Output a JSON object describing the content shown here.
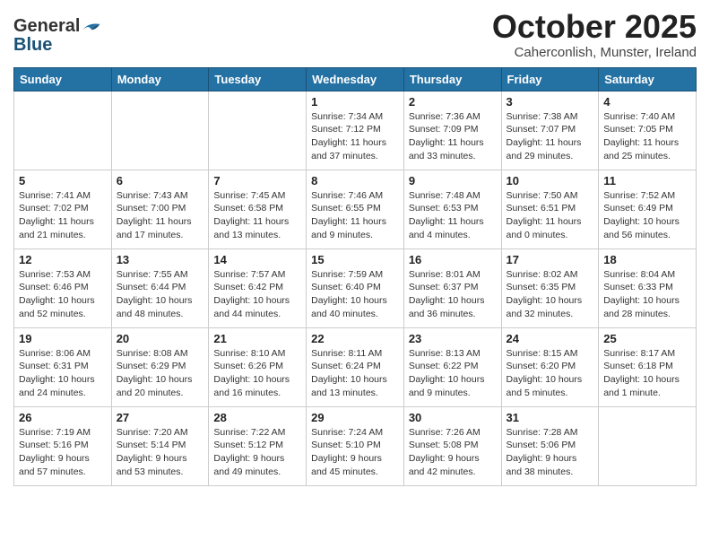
{
  "header": {
    "logo_general": "General",
    "logo_blue": "Blue",
    "month": "October 2025",
    "location": "Caherconlish, Munster, Ireland"
  },
  "weekdays": [
    "Sunday",
    "Monday",
    "Tuesday",
    "Wednesday",
    "Thursday",
    "Friday",
    "Saturday"
  ],
  "weeks": [
    [
      {
        "day": "",
        "info": ""
      },
      {
        "day": "",
        "info": ""
      },
      {
        "day": "",
        "info": ""
      },
      {
        "day": "1",
        "info": "Sunrise: 7:34 AM\nSunset: 7:12 PM\nDaylight: 11 hours\nand 37 minutes."
      },
      {
        "day": "2",
        "info": "Sunrise: 7:36 AM\nSunset: 7:09 PM\nDaylight: 11 hours\nand 33 minutes."
      },
      {
        "day": "3",
        "info": "Sunrise: 7:38 AM\nSunset: 7:07 PM\nDaylight: 11 hours\nand 29 minutes."
      },
      {
        "day": "4",
        "info": "Sunrise: 7:40 AM\nSunset: 7:05 PM\nDaylight: 11 hours\nand 25 minutes."
      }
    ],
    [
      {
        "day": "5",
        "info": "Sunrise: 7:41 AM\nSunset: 7:02 PM\nDaylight: 11 hours\nand 21 minutes."
      },
      {
        "day": "6",
        "info": "Sunrise: 7:43 AM\nSunset: 7:00 PM\nDaylight: 11 hours\nand 17 minutes."
      },
      {
        "day": "7",
        "info": "Sunrise: 7:45 AM\nSunset: 6:58 PM\nDaylight: 11 hours\nand 13 minutes."
      },
      {
        "day": "8",
        "info": "Sunrise: 7:46 AM\nSunset: 6:55 PM\nDaylight: 11 hours\nand 9 minutes."
      },
      {
        "day": "9",
        "info": "Sunrise: 7:48 AM\nSunset: 6:53 PM\nDaylight: 11 hours\nand 4 minutes."
      },
      {
        "day": "10",
        "info": "Sunrise: 7:50 AM\nSunset: 6:51 PM\nDaylight: 11 hours\nand 0 minutes."
      },
      {
        "day": "11",
        "info": "Sunrise: 7:52 AM\nSunset: 6:49 PM\nDaylight: 10 hours\nand 56 minutes."
      }
    ],
    [
      {
        "day": "12",
        "info": "Sunrise: 7:53 AM\nSunset: 6:46 PM\nDaylight: 10 hours\nand 52 minutes."
      },
      {
        "day": "13",
        "info": "Sunrise: 7:55 AM\nSunset: 6:44 PM\nDaylight: 10 hours\nand 48 minutes."
      },
      {
        "day": "14",
        "info": "Sunrise: 7:57 AM\nSunset: 6:42 PM\nDaylight: 10 hours\nand 44 minutes."
      },
      {
        "day": "15",
        "info": "Sunrise: 7:59 AM\nSunset: 6:40 PM\nDaylight: 10 hours\nand 40 minutes."
      },
      {
        "day": "16",
        "info": "Sunrise: 8:01 AM\nSunset: 6:37 PM\nDaylight: 10 hours\nand 36 minutes."
      },
      {
        "day": "17",
        "info": "Sunrise: 8:02 AM\nSunset: 6:35 PM\nDaylight: 10 hours\nand 32 minutes."
      },
      {
        "day": "18",
        "info": "Sunrise: 8:04 AM\nSunset: 6:33 PM\nDaylight: 10 hours\nand 28 minutes."
      }
    ],
    [
      {
        "day": "19",
        "info": "Sunrise: 8:06 AM\nSunset: 6:31 PM\nDaylight: 10 hours\nand 24 minutes."
      },
      {
        "day": "20",
        "info": "Sunrise: 8:08 AM\nSunset: 6:29 PM\nDaylight: 10 hours\nand 20 minutes."
      },
      {
        "day": "21",
        "info": "Sunrise: 8:10 AM\nSunset: 6:26 PM\nDaylight: 10 hours\nand 16 minutes."
      },
      {
        "day": "22",
        "info": "Sunrise: 8:11 AM\nSunset: 6:24 PM\nDaylight: 10 hours\nand 13 minutes."
      },
      {
        "day": "23",
        "info": "Sunrise: 8:13 AM\nSunset: 6:22 PM\nDaylight: 10 hours\nand 9 minutes."
      },
      {
        "day": "24",
        "info": "Sunrise: 8:15 AM\nSunset: 6:20 PM\nDaylight: 10 hours\nand 5 minutes."
      },
      {
        "day": "25",
        "info": "Sunrise: 8:17 AM\nSunset: 6:18 PM\nDaylight: 10 hours\nand 1 minute."
      }
    ],
    [
      {
        "day": "26",
        "info": "Sunrise: 7:19 AM\nSunset: 5:16 PM\nDaylight: 9 hours\nand 57 minutes."
      },
      {
        "day": "27",
        "info": "Sunrise: 7:20 AM\nSunset: 5:14 PM\nDaylight: 9 hours\nand 53 minutes."
      },
      {
        "day": "28",
        "info": "Sunrise: 7:22 AM\nSunset: 5:12 PM\nDaylight: 9 hours\nand 49 minutes."
      },
      {
        "day": "29",
        "info": "Sunrise: 7:24 AM\nSunset: 5:10 PM\nDaylight: 9 hours\nand 45 minutes."
      },
      {
        "day": "30",
        "info": "Sunrise: 7:26 AM\nSunset: 5:08 PM\nDaylight: 9 hours\nand 42 minutes."
      },
      {
        "day": "31",
        "info": "Sunrise: 7:28 AM\nSunset: 5:06 PM\nDaylight: 9 hours\nand 38 minutes."
      },
      {
        "day": "",
        "info": ""
      }
    ]
  ]
}
